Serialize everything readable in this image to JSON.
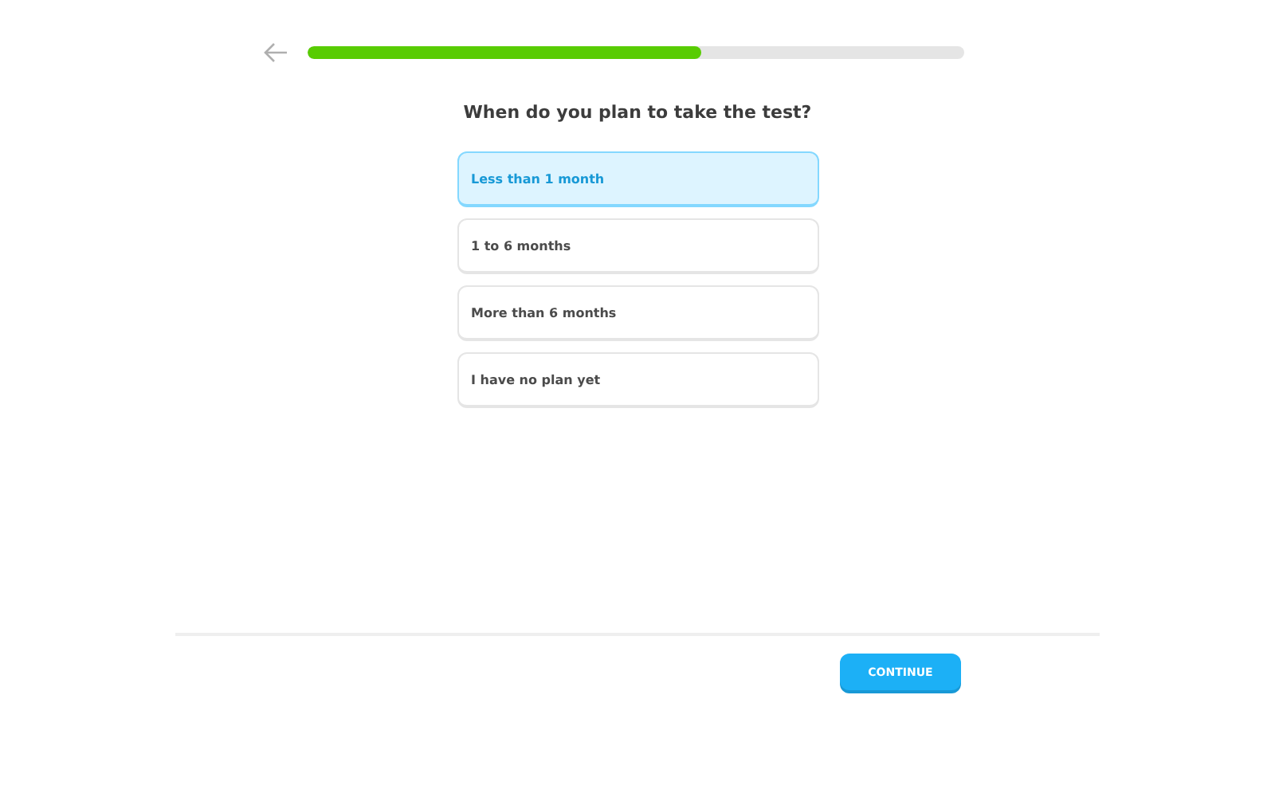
{
  "progress": {
    "level": 0.6
  },
  "question": "When do you plan to take the test?",
  "options": [
    {
      "label": "Less than 1 month",
      "selected": true
    },
    {
      "label": "1 to 6 months",
      "selected": false
    },
    {
      "label": "More than 6 months",
      "selected": false
    },
    {
      "label": "I have no plan yet",
      "selected": false
    }
  ],
  "continue_button": {
    "label": "CONTINUE",
    "disabled": false
  }
}
